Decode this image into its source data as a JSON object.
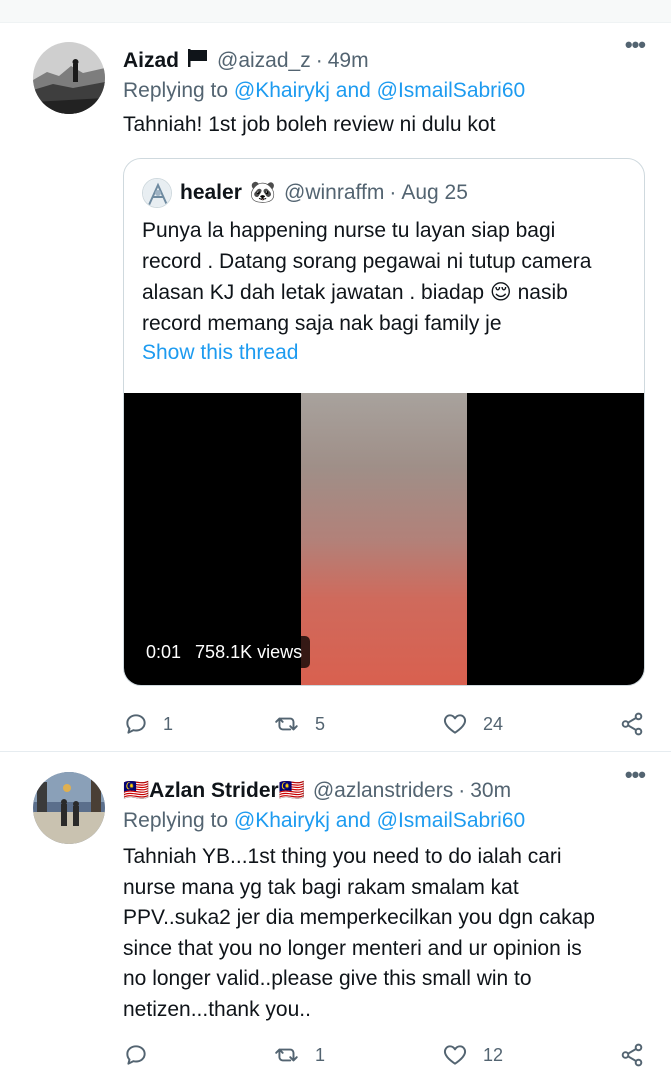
{
  "colors": {
    "link": "#1d9bf0",
    "secondary_text": "#536471",
    "primary_text": "#0f1419",
    "border": "#cfd9de"
  },
  "tweets": [
    {
      "name": "Aizad",
      "name_suffix_icon": "black-flag-icon",
      "handle": "@aizad_z",
      "separator": "·",
      "time": "49m",
      "more_label": "•••",
      "replying_prefix": "Replying to",
      "replying_to_1": "@Khairykj",
      "replying_and": "and",
      "replying_to_2": "@IsmailSabri60",
      "text": "Tahniah! 1st job boleh review ni dulu kot",
      "quote": {
        "name": "healer",
        "name_emoji": "🐼",
        "handle": "@winraffm",
        "separator": "·",
        "date": "Aug 25",
        "text_line1": "Punya la happening nurse tu layan siap bagi",
        "text_line2": "record . Datang sorang pegawai ni tutup camera",
        "text_line3": "alasan KJ dah letak jawatan . biadap 😌  nasib",
        "text_line4": "record memang saja nak bagi family je",
        "show_thread": "Show this thread",
        "video_time": "0:01",
        "video_views": "758.1K views"
      },
      "replies": "1",
      "retweets": "5",
      "likes": "24"
    },
    {
      "name_prefix_flag": "🇲🇾",
      "name": "Azlan Strider",
      "name_suffix_flag": "🇲🇾",
      "handle": "@azlanstriders",
      "separator": "·",
      "time": "30m",
      "more_label": "•••",
      "replying_prefix": "Replying to",
      "replying_to_1": "@Khairykj",
      "replying_and": "and",
      "replying_to_2": "@IsmailSabri60",
      "text_line1": "Tahniah YB...1st thing you need to do ialah cari",
      "text_line2": "nurse mana yg tak bagi rakam smalam kat",
      "text_line3": "PPV..suka2 jer dia memperkecilkan you dgn cakap",
      "text_line4": "since that you no longer menteri and ur opinion is",
      "text_line5": "no longer valid..please give this small win to",
      "text_line6": "netizen...thank you..",
      "replies": "",
      "retweets": "1",
      "likes": "12"
    }
  ]
}
